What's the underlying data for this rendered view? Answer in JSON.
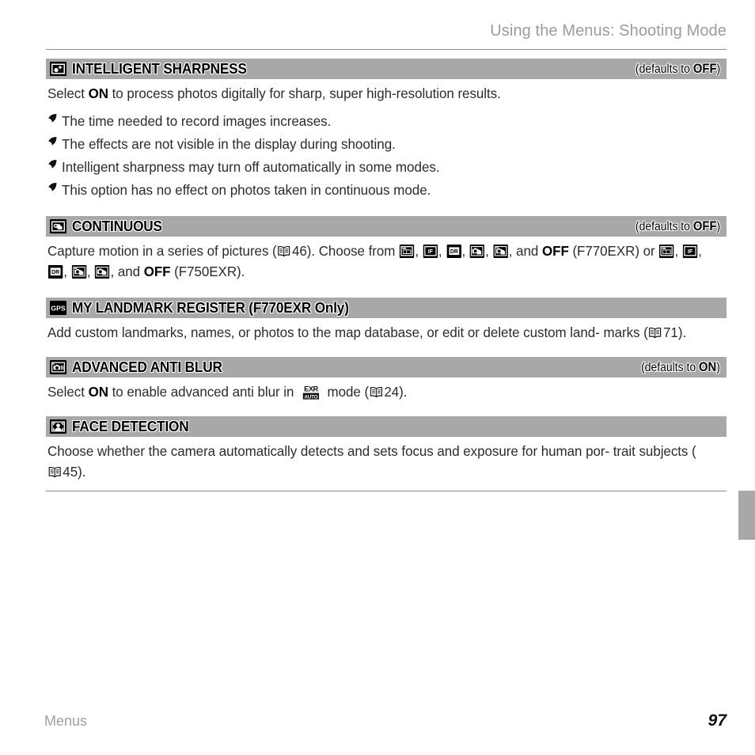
{
  "header": {
    "running_title": "Using the Menus: Shooting Mode"
  },
  "footer": {
    "section_label": "Menus",
    "page_number": "97"
  },
  "colors": {
    "section_bar": "#a8a8a8",
    "rule": "#8e8e8e",
    "header_text": "#9c9c9c",
    "body_text": "#2b2b2b",
    "thumb_tab": "#a8a8a8"
  },
  "sections": [
    {
      "icon": "intelligent-sharpness-icon",
      "title": "INTELLIGENT SHARPNESS",
      "defaults_prefix": "(defaults to ",
      "defaults_value": "OFF",
      "defaults_suffix": ")",
      "body_lead": "Select ",
      "body_bold": "ON",
      "body_tail": " to process photos digitally for sharp, super high-resolution results.",
      "notes": [
        "The time needed to record images increases.",
        "The effects are not visible in the display during shooting.",
        "Intelligent sharpness may turn off automatically in some modes.",
        "This option has no effect on photos taken in continuous mode."
      ]
    },
    {
      "icon": "continuous-icon",
      "title": "CONTINUOUS",
      "defaults_prefix": "(defaults to ",
      "defaults_value": "OFF",
      "defaults_suffix": ")",
      "body_line1_a": "Capture motion in a series of pictures (",
      "body_line1_page": "46",
      "body_line1_b": "). Choose from ",
      "body_line1_sep": ", ",
      "body_line1_and": ", and ",
      "body_line1_off": "OFF",
      "body_line1_model": " (F770EXR)",
      "body_line2_a": "or ",
      "body_line2_and": ", and ",
      "body_line2_off": "OFF",
      "body_line2_model": " (F750EXR).",
      "icons_line1": [
        "burst-frames-icon",
        "if-badge-icon",
        "dr-badge-icon",
        "camera-stack-icon",
        "camera-stack-alt-icon"
      ],
      "icons_line2": [
        "burst-frames-icon",
        "if-badge-icon",
        "dr-badge-icon",
        "camera-stack-alt-icon",
        "camera-stack-icon"
      ]
    },
    {
      "icon": "gps-icon",
      "title": "MY LANDMARK REGISTER (F770EXR Only)",
      "defaults_prefix": "",
      "defaults_value": "",
      "defaults_suffix": "",
      "body_line1": "Add custom landmarks, names, or photos to the map database, or edit or delete custom land-",
      "body_line2_a": "marks (",
      "body_line2_page": "71",
      "body_line2_b": ")."
    },
    {
      "icon": "anti-blur-icon",
      "title": "ADVANCED ANTI BLUR",
      "defaults_prefix": "(defaults to ",
      "defaults_value": "ON",
      "defaults_suffix": ")",
      "body_a": "Select ",
      "body_bold": "ON",
      "body_b": " to enable advanced anti blur in ",
      "body_mode_icon": "exr-auto-icon",
      "body_c": " mode (",
      "body_page": "24",
      "body_d": ")."
    },
    {
      "icon": "face-detection-icon",
      "title": "FACE DETECTION",
      "defaults_prefix": "",
      "defaults_value": "",
      "defaults_suffix": "",
      "body_line1": "Choose whether the camera automatically detects and sets focus and exposure for human por-",
      "body_line2_a": "trait subjects (",
      "body_line2_page": "45",
      "body_line2_b": ")."
    }
  ]
}
